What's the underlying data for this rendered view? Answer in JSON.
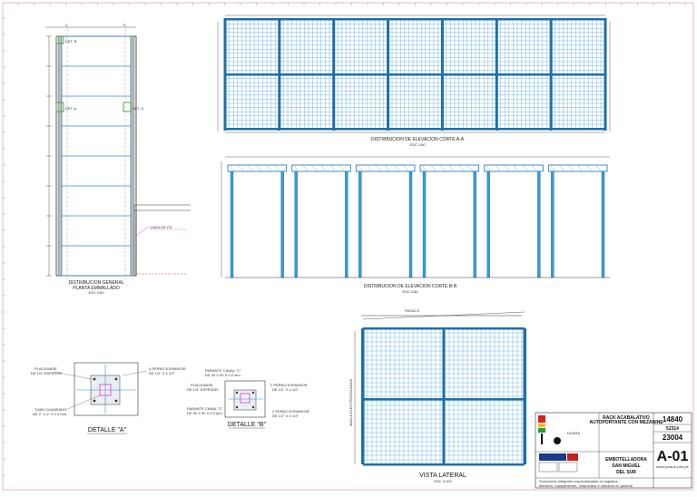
{
  "colors": {
    "steel": "#2a8fd0",
    "mesh": "#3a9ad8",
    "frame": "#1f6fa8",
    "dimension": "#333333",
    "marker": "#d04040",
    "highlight": "#2c9a2c",
    "accent": "#c040c0"
  },
  "plan": {
    "marker_a": "A",
    "marker_b": "B",
    "det_a": "DET. A",
    "det_b": "DET. B",
    "note": "LINEA DE PX",
    "title_1": "DISTRIBUCION GENERAL",
    "title_2": "PLANTA EMMALLADO",
    "scale": "ESC 1/50"
  },
  "elev_a": {
    "title": "DISTRIBUCION DE ELEVACION CORTE A-A",
    "scale": "ESC 1/50",
    "bays": 7
  },
  "elev_b": {
    "title": "DISTRIBUCION DE ELEVACION CORTE B-B",
    "scale": "ESC 1/50",
    "bays": 6
  },
  "detail_a": {
    "title": "DETALLE \"A\"",
    "l1a": "PLACA BASE",
    "l1b": "DE 1/4\" ESPESOR",
    "l2a": "4 PERNO EXPANSOR",
    "l2b": "DE 1/2\" X 4 1/2\"",
    "l3a": "TUBO CUADRADO",
    "l3b": "DE 2\" X 2\" X 2.0 mm"
  },
  "detail_b": {
    "title": "DETALLE \"B\"",
    "l1a": "PARANTE CANAL \"C\"",
    "l1b": "DE 90 X 50 X 2.0 mm",
    "l2a": "PLACA BASE",
    "l2b": "DE 1/4\" ESPESOR",
    "l3a": "2 PERNO EXPANSOR",
    "l3b": "DE 1/2\" X 4 1/2\"",
    "l4a": "PARANTE CANAL \"C\"",
    "l4b": "DE 90 X 50 X 2.0 mm",
    "l5a": "2 PERNO EXPANSOR",
    "l5b": "DE 1/2\" X 4 1/2\""
  },
  "side": {
    "title": "VISTA LATERAL",
    "scale": "ESC 1/100",
    "top_dim": "PASILLO",
    "height_dim": "MALLA ELECTROSOLDADA"
  },
  "title_block": {
    "client": "HUARA",
    "project_1": "RACK ACABALATIVO",
    "project_2": "AUTOPORTANTE CON MEZANINE",
    "client_1": "EMBOTELLADORA",
    "client_2": "SAN MIGUEL",
    "client_3": "DEL SUR",
    "num_1": "14840",
    "num_2": "52314",
    "num_3": "23004",
    "sheet": "A-01",
    "website": "www.prosus.com.pe",
    "footer_1": "Soluciones integrales especializadas en logistica,",
    "footer_2": "almacen, equipamiento, maquinaria e industria en general"
  }
}
